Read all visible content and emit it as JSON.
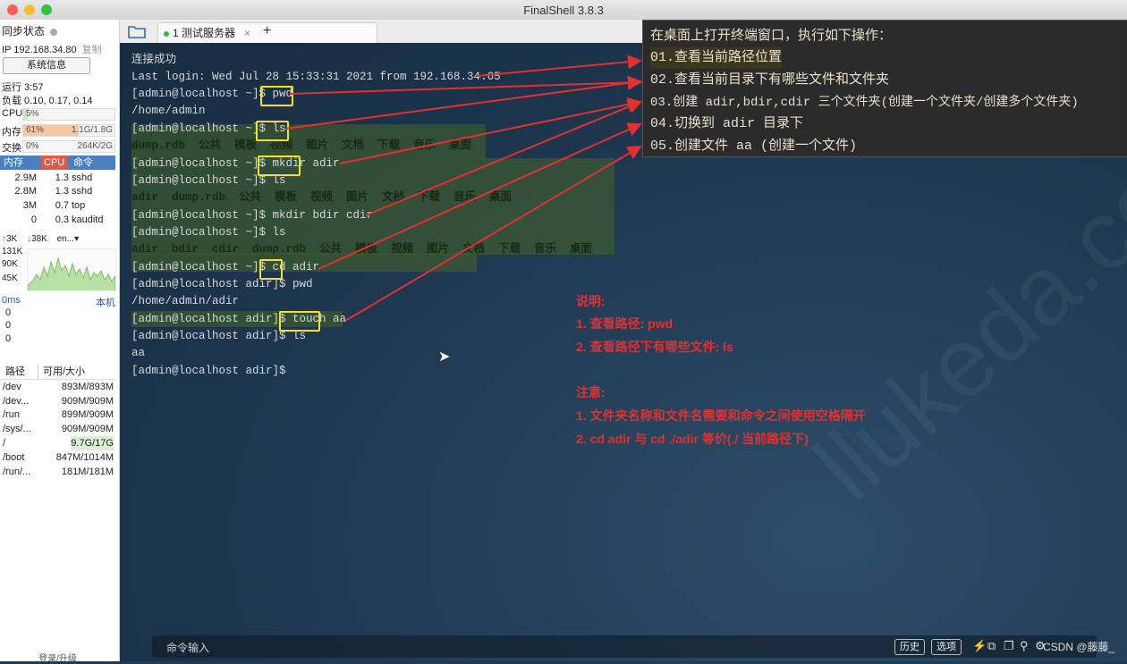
{
  "window": {
    "title": "FinalShell 3.8.3"
  },
  "sidebar": {
    "sync_status": "同步状态",
    "ip": "IP 192.168.34.80",
    "copy": "复制",
    "sysinfo_button": "系统信息",
    "uptime": "运行 3:57",
    "load": "负载 0.10, 0.17, 0.14",
    "cpu_label": "CPU",
    "cpu_value": "5%",
    "cpu_fraction": 0.05,
    "mem_label": "内存",
    "mem_value": "61%",
    "mem_detail": "1.1G/1.8G",
    "mem_fraction": 0.61,
    "swap_label": "交换",
    "swap_value": "0%",
    "swap_detail": "264K/2G",
    "process_headers": [
      "内存",
      "CPU",
      "命令"
    ],
    "processes": [
      {
        "mem": "2.9M",
        "cpu": "1.3",
        "cmd": "sshd"
      },
      {
        "mem": "2.8M",
        "cpu": "1.3",
        "cmd": "sshd"
      },
      {
        "mem": "3M",
        "cpu": "0.7",
        "cmd": "top"
      },
      {
        "mem": "0",
        "cpu": "0.3",
        "cmd": "kauditd"
      }
    ],
    "net_up": "3K",
    "net_down": "38K",
    "net_iface": "en...",
    "net_scale": [
      "131K",
      "90K",
      "45K"
    ],
    "latency_label": "0ms",
    "latency_host": "本机",
    "latency_values": [
      "0",
      "0",
      "0"
    ],
    "fs_headers": [
      "路径",
      "可用/大小"
    ],
    "filesystems": [
      {
        "path": "/dev",
        "size": "893M/893M"
      },
      {
        "path": "/dev...",
        "size": "909M/909M"
      },
      {
        "path": "/run",
        "size": "899M/909M"
      },
      {
        "path": "/sys/...",
        "size": "909M/909M"
      },
      {
        "path": "/",
        "size": "9.7G/17G"
      },
      {
        "path": "/boot",
        "size": "847M/1014M"
      },
      {
        "path": "/run/...",
        "size": "181M/181M"
      }
    ],
    "login_upgrade": "登录/升级"
  },
  "tabs": [
    {
      "label": "1 测试服务器",
      "close": "×"
    }
  ],
  "tab_add": "+",
  "terminal": {
    "lines": [
      "连接成功",
      "Last login: Wed Jul 28 15:33:31 2021 from 192.168.34.65",
      "[admin@localhost ~]$ pwd",
      "/home/admin",
      "[admin@localhost ~]$ ls",
      "dump.rdb  公共  模板  视频  图片  文档  下载  音乐  桌面",
      "[admin@localhost ~]$ mkdir adir",
      "[admin@localhost ~]$ ls",
      "adir  dump.rdb  公共  模板  视频  图片  文档  下载  音乐  桌面",
      "[admin@localhost ~]$ mkdir bdir cdir",
      "[admin@localhost ~]$ ls",
      "adir  bdir  cdir  dump.rdb  公共  模板  视频  图片  文档  下载  音乐  桌面",
      "[admin@localhost ~]$ cd adir",
      "[admin@localhost adir]$ pwd",
      "/home/admin/adir",
      "[admin@localhost adir]$ touch aa",
      "[admin@localhost adir]$ ls",
      "aa",
      "[admin@localhost adir]$"
    ]
  },
  "steps_panel": {
    "title": "在桌面上打开终端窗口，执行如下操作：",
    "items": [
      "01.查看当前路径位置",
      "02.查看当前目录下有哪些文件和文件夹",
      "03.创建 adir,bdir,cdir 三个文件夹(创建一个文件夹/创建多个文件夹)",
      "04.切换到 adir 目录下",
      "05.创建文件 aa (创建一个文件)"
    ]
  },
  "notes": {
    "explain_title": "说明:",
    "explain_1": "1. 查看路径: pwd",
    "explain_2": "2. 查看路径下有哪些文件: ls",
    "note_title": "注意:",
    "note_1": "1. 文件夹名称和文件名需要和命令之间使用空格隔开",
    "note_2": "2. cd adir 与 cd ./adir 等价(./ 当前路径下)"
  },
  "command_bar": {
    "label": "命令输入",
    "history": "历史",
    "options": "选项",
    "credit": "CSDN @藤藤_"
  },
  "colors": {
    "accent_red": "#e23030",
    "highlight_yellow": "#f5e11f",
    "terminal_bg": "#1e3851"
  }
}
